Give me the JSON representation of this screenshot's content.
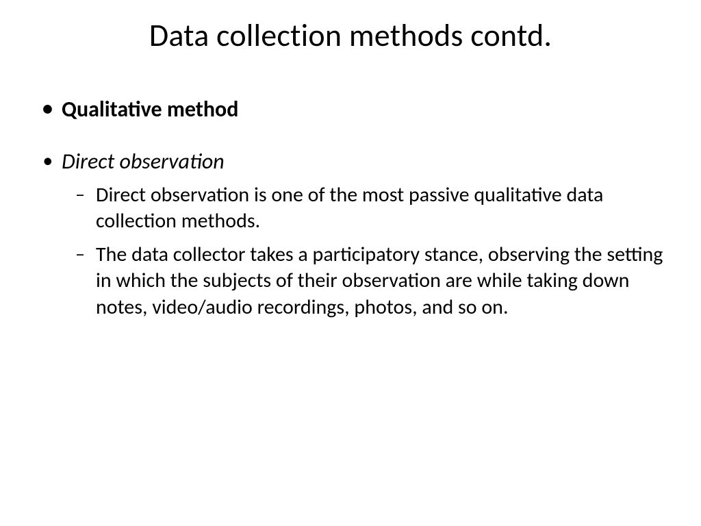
{
  "slide": {
    "title": "Data collection methods contd.",
    "bullets": {
      "qualitative": "Qualitative method",
      "direct_obs": "Direct observation",
      "sub1": "Direct observation is one of the most passive qualitative data collection methods.",
      "sub2": "The data collector takes a participatory stance, observing the setting in which the subjects of their observation are while taking down notes, video/audio recordings, photos, and so on."
    }
  }
}
